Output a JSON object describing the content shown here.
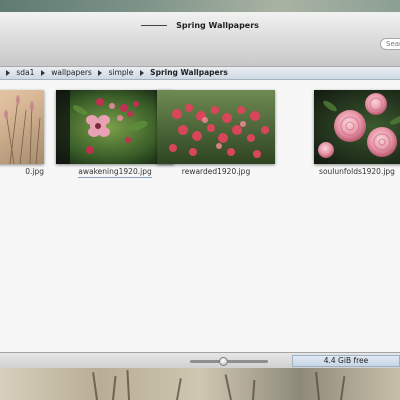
{
  "window": {
    "title": "Spring Wallpapers",
    "search_placeholder": "Search"
  },
  "pathbar": {
    "crumbs": [
      "sda1",
      "wallpapers",
      "simple",
      "Spring Wallpapers"
    ]
  },
  "files": [
    {
      "name": "...0.jpg",
      "display": "0.jpg",
      "palette": [
        "#e9c9a6",
        "#b48f6a",
        "#c77a8a"
      ]
    },
    {
      "name": "awakening1920.jpg",
      "palette": [
        "#2c4a22",
        "#5e8a3a",
        "#e9a8b8"
      ]
    },
    {
      "name": "rewarded1920.jpg",
      "palette": [
        "#3a5a2a",
        "#7a9a4a",
        "#d44a5a"
      ]
    },
    {
      "name": "soulunfolds1920.jpg",
      "palette": [
        "#1d2f1a",
        "#e08aa0",
        "#f6c3cf"
      ]
    }
  ],
  "statusbar": {
    "zoom_level": 0.42,
    "free_space": "4.4 GiB free"
  },
  "colors": {
    "toolbar_top": "#f2f2f2",
    "toolbar_bottom": "#c8c8c8",
    "pathbar": "#d6e0ea",
    "content_bg": "#f7f7f7"
  }
}
